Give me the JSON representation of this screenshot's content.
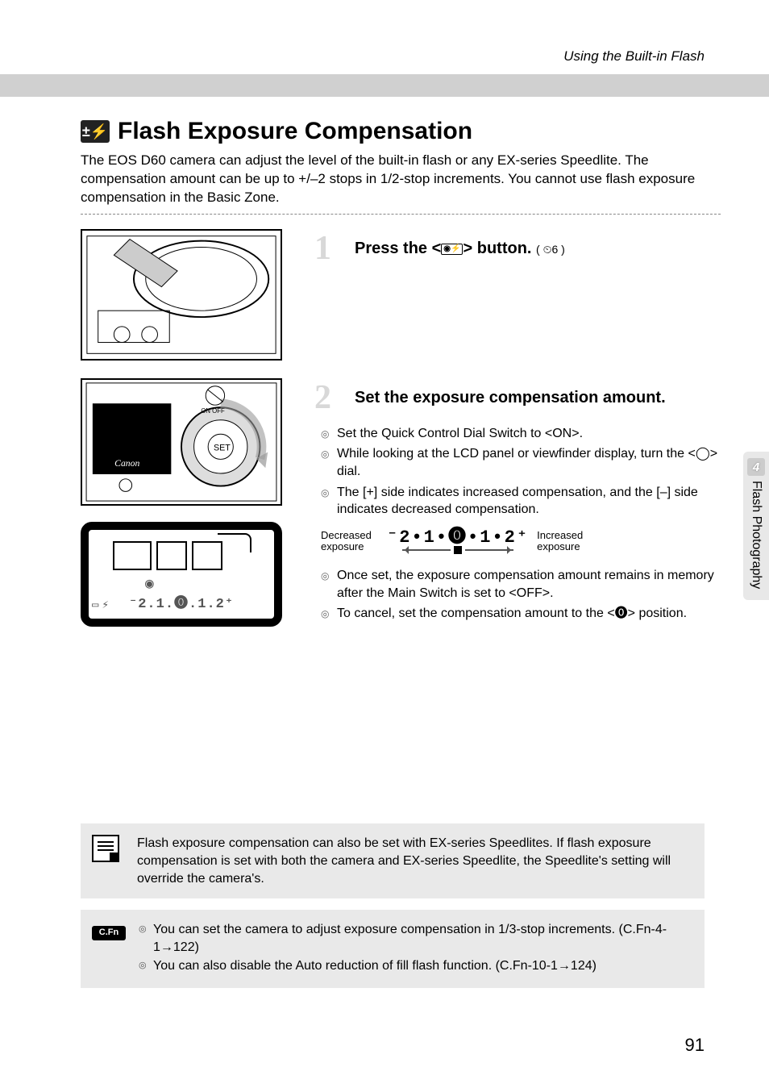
{
  "header": {
    "breadcrumb": "Using the Built-in Flash"
  },
  "section": {
    "icon_label": "±⚡",
    "title": "Flash Exposure Compensation",
    "intro": "The EOS D60 camera can adjust the level of the built-in flash or any EX-series Speedlite. The compensation amount can be up to +/–2 stops in 1/2-stop increments. You cannot use flash exposure compensation in the Basic Zone."
  },
  "steps": [
    {
      "num": "1",
      "title_prefix": "Press the <",
      "title_suffix": "> button.",
      "timer": "( ⏲6 )",
      "bullets": []
    },
    {
      "num": "2",
      "title": "Set the exposure compensation amount.",
      "bullets_a": [
        "Set the Quick Control Dial Switch to <ON>.",
        "While looking at the LCD panel or viewfinder display, turn the <◯> dial.",
        "The [+] side indicates increased compensation, and the [–] side indicates decreased compensation."
      ],
      "scale": {
        "decreased": "Decreased exposure",
        "increased": "Increased exposure",
        "nums": "⁻2•1•⓿•1•2⁺"
      },
      "bullets_b": [
        "Once set, the exposure compensation amount remains in memory after the Main Switch is set to <OFF>.",
        "To cancel, set the compensation amount to the <⓿> position."
      ]
    }
  ],
  "lcd": {
    "scale_text": "⁻2.1.⓿.1.2⁺",
    "canon": "Canon"
  },
  "sidebar": {
    "chapter_num": "4",
    "chapter_title": "Flash Photography"
  },
  "notes": {
    "info": "Flash exposure compensation can also be set with EX-series Speedlites. If flash exposure compensation is set with both the camera and EX-series Speedlite, the Speedlite's setting will override the camera's.",
    "cfn_label": "C.Fn",
    "cfn_items": [
      "You can set the camera to adjust exposure compensation in 1/3-stop increments. (C.Fn-4-1→122)",
      "You can also disable the Auto reduction of fill flash function. (C.Fn-10-1→124)"
    ]
  },
  "page_number": "91"
}
